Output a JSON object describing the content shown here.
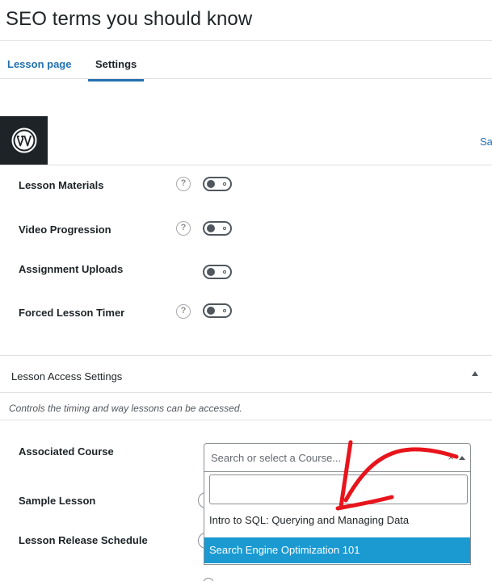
{
  "page": {
    "title": "SEO terms you should know"
  },
  "tabs": [
    {
      "label": "Lesson page",
      "active": false
    },
    {
      "label": "Settings",
      "active": true
    }
  ],
  "header": {
    "edge_link_text": "Sa"
  },
  "settings_rows": [
    {
      "label": "Lesson Materials",
      "help": "?",
      "enabled": false
    },
    {
      "label": "Video Progression",
      "help": "?",
      "enabled": false
    },
    {
      "label": "Assignment Uploads",
      "enabled": false
    },
    {
      "label": "Forced Lesson Timer",
      "help": "?",
      "enabled": false
    }
  ],
  "access_section": {
    "title": "Lesson Access Settings",
    "description": "Controls the timing and way lessons can be accessed.",
    "associated_course": {
      "label": "Associated Course",
      "placeholder": "Search or select a Course...",
      "clear_glyph": "×",
      "search_value": "",
      "options": [
        {
          "label": "Intro to SQL: Querying and Managing Data",
          "highlighted": false
        },
        {
          "label": "Search Engine Optimization 101",
          "highlighted": true
        }
      ]
    },
    "sample_lesson": {
      "label": "Sample Lesson"
    },
    "release_schedule": {
      "label": "Lesson Release Schedule"
    }
  },
  "colors": {
    "accent": "#2271b1",
    "highlight": "#1b9ad2",
    "annotation_arrow": "#e8141c",
    "wp_logo_bg": "#1d2327"
  },
  "icons": [
    "wordpress-logo-icon",
    "help-icon",
    "caret-up-icon",
    "chevron-up-icon",
    "annotation-arrow"
  ]
}
